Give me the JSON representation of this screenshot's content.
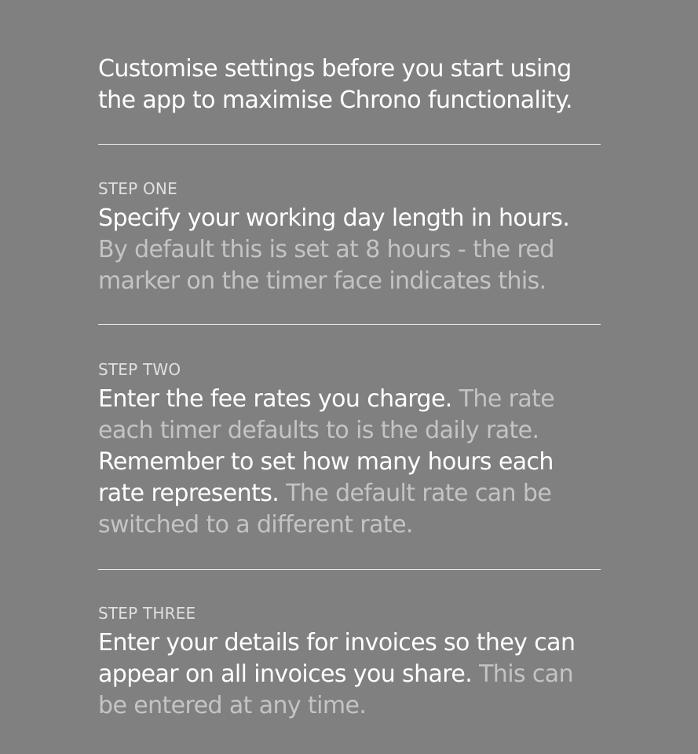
{
  "intro": {
    "text": "Customise settings before you start using the app to maximise Chrono functionality."
  },
  "steps": [
    {
      "label": "STEP ONE",
      "segments": [
        {
          "style": "hl",
          "text": "Specify your working day length in hours."
        },
        {
          "style": "dim",
          "text": " By default this is set at 8 hours - the red marker on the timer face indicates this."
        }
      ]
    },
    {
      "label": "STEP TWO",
      "segments": [
        {
          "style": "hl",
          "text": "Enter the fee rates you charge."
        },
        {
          "style": "dim",
          "text": " The rate each timer defaults to is the daily rate."
        },
        {
          "style": "hl",
          "text": " Remember to set how many hours each rate represents."
        },
        {
          "style": "dim",
          "text": " The default rate can be switched to a different rate."
        }
      ]
    },
    {
      "label": "STEP THREE",
      "segments": [
        {
          "style": "hl",
          "text": "Enter your details for invoices so they can appear on all invoices you share."
        },
        {
          "style": "dim",
          "text": " This can be entered at any time."
        }
      ]
    }
  ]
}
